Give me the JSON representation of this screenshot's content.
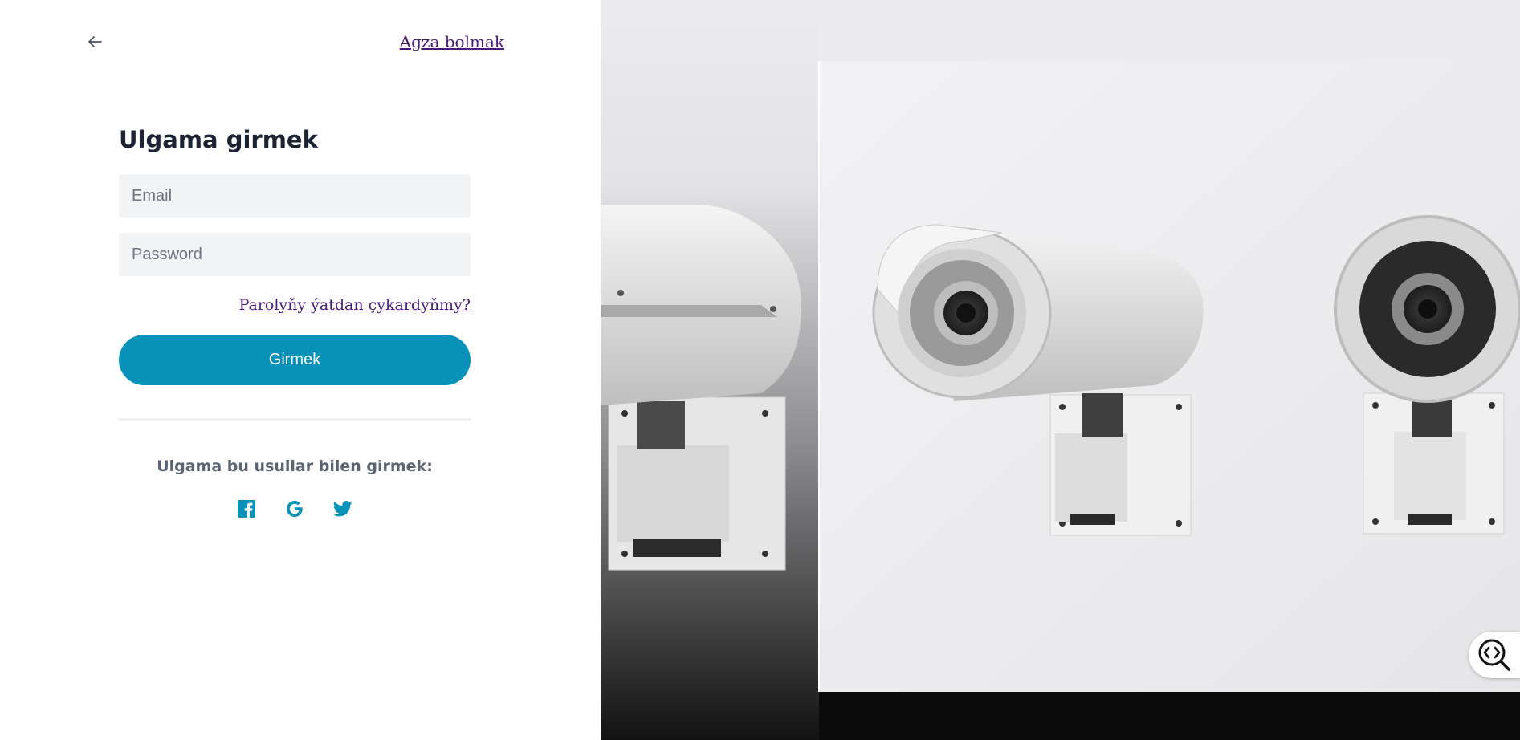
{
  "header": {
    "back_icon": "arrow-left-icon",
    "register_link": "Agza bolmak"
  },
  "login_form": {
    "title": "Ulgama girmek",
    "email_placeholder": "Email",
    "email_value": "",
    "password_placeholder": "Password",
    "password_value": "",
    "forgot_password_link": "Parolyňy ýatdan çykardyňmy?",
    "submit_label": "Girmek"
  },
  "social_login": {
    "label": "Ulgama bu usullar bilen girmek:",
    "providers": [
      {
        "name": "facebook",
        "icon": "facebook-icon"
      },
      {
        "name": "google",
        "icon": "google-icon"
      },
      {
        "name": "twitter",
        "icon": "twitter-icon"
      }
    ]
  },
  "hero": {
    "image_subject": "security-cameras",
    "preview_button_icon": "code-search-icon"
  },
  "colors": {
    "accent": "#0892b8",
    "link": "#4a1a7a",
    "heading": "#1c2433",
    "input_bg": "#f3f4f6"
  }
}
